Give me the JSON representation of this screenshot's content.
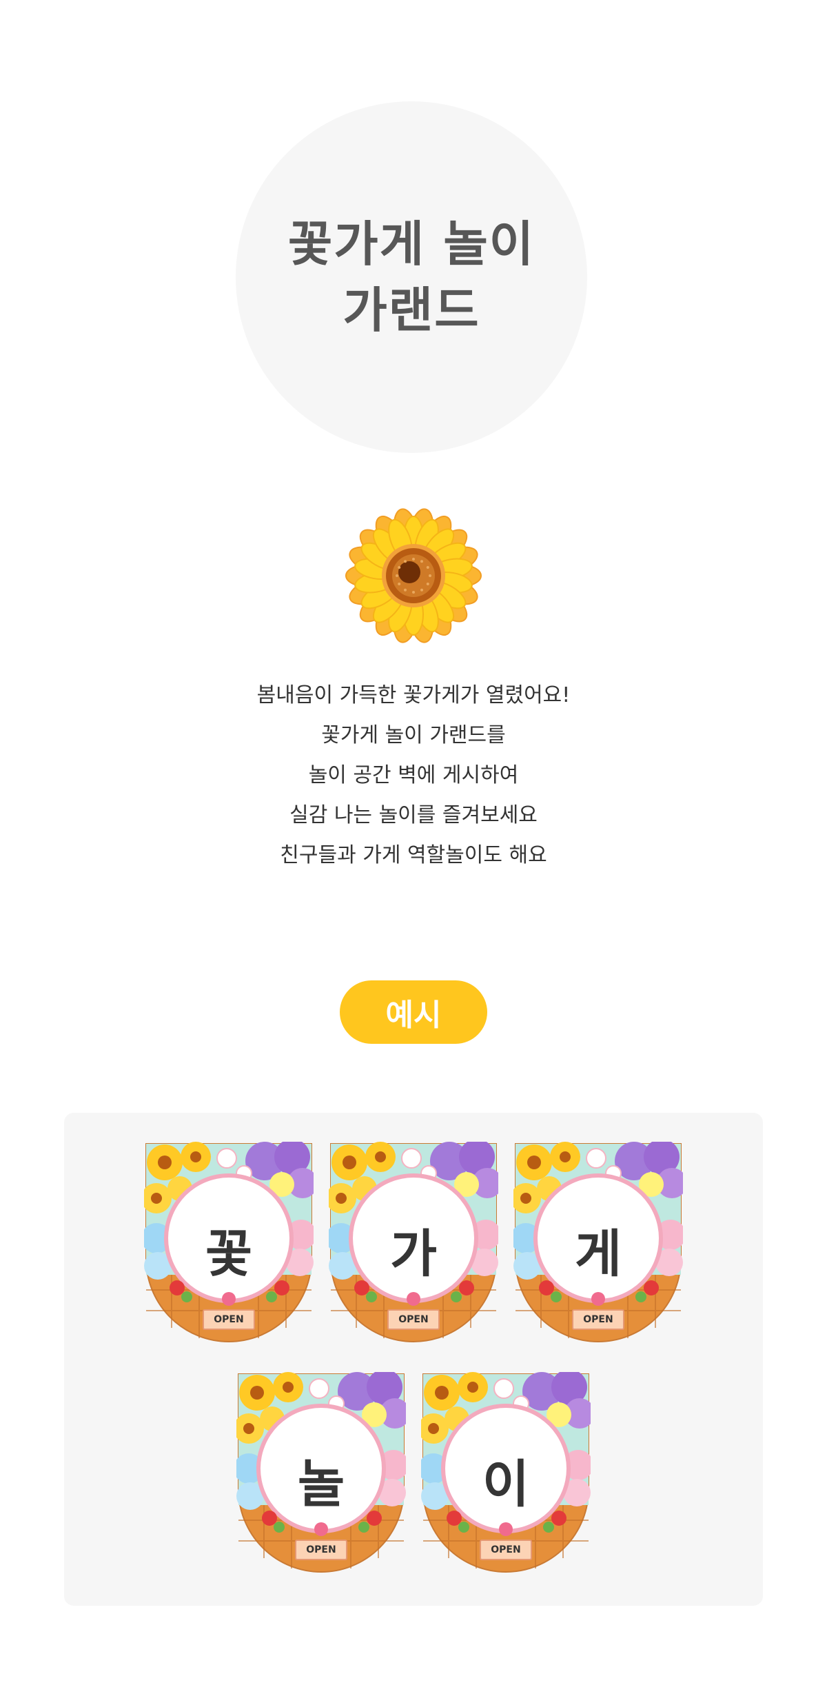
{
  "header": {
    "title_lines": [
      "꽃가게 놀이",
      "가랜드"
    ]
  },
  "illustration": {
    "icon": "sunflower-icon",
    "colors": {
      "petal": "#ffd21f",
      "center": "#b85c12"
    }
  },
  "description": {
    "lines": [
      "봄내음이 가득한 꽃가게가 열렸어요!",
      "꽃가게 놀이 가랜드를",
      "놀이 공간 벽에 게시하여",
      "실감 나는 놀이를 즐겨보세요",
      "친구들과 가게 역할놀이도 해요"
    ]
  },
  "example": {
    "label": "예시",
    "accent": "#ffc61e",
    "flags": [
      {
        "char": "꽃",
        "sign": "OPEN"
      },
      {
        "char": "가",
        "sign": "OPEN"
      },
      {
        "char": "게",
        "sign": "OPEN"
      },
      {
        "char": "놀",
        "sign": "OPEN"
      },
      {
        "char": "이",
        "sign": "OPEN"
      }
    ]
  }
}
